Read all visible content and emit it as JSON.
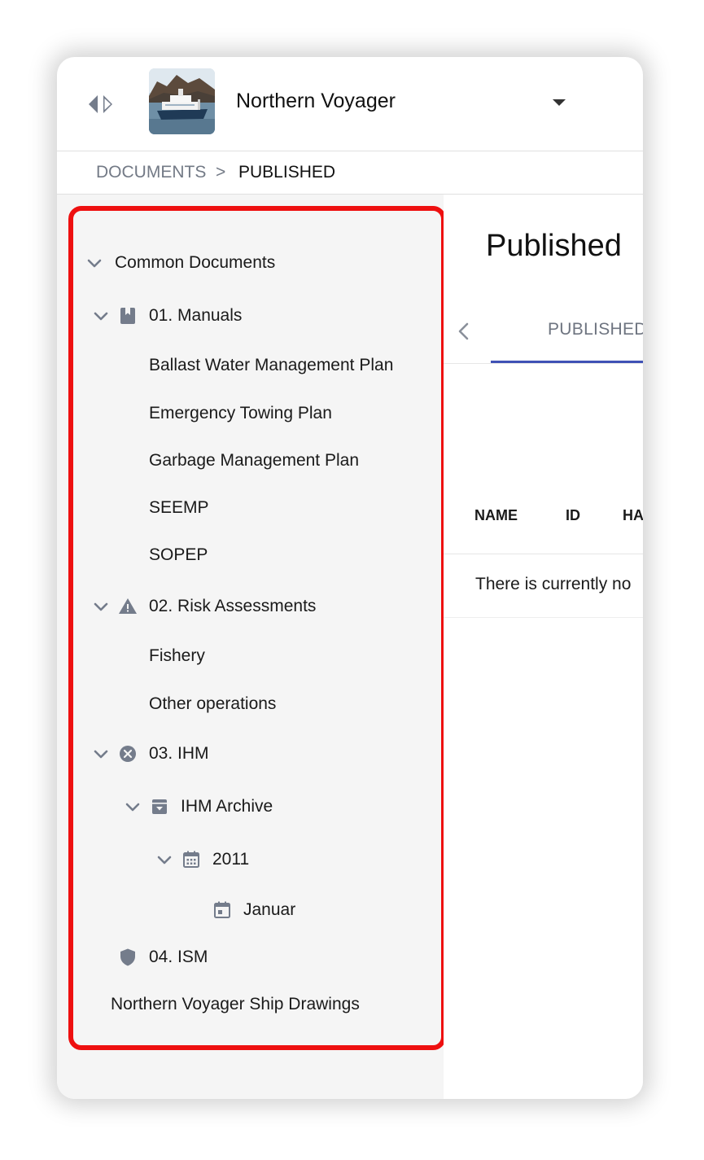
{
  "header": {
    "vessel_name": "Northern Voyager"
  },
  "breadcrumb": {
    "documents": "DOCUMENTS",
    "separator": ">",
    "current": "PUBLISHED"
  },
  "sidebar": {
    "root": "Common Documents",
    "manuals": {
      "label": "01. Manuals",
      "items": [
        "Ballast Water Management Plan",
        "Emergency Towing Plan",
        "Garbage Management Plan",
        "SEEMP",
        "SOPEP"
      ]
    },
    "risk": {
      "label": "02. Risk Assessments",
      "items": [
        "Fishery",
        "Other operations"
      ]
    },
    "ihm": {
      "label": "03. IHM",
      "archive": "IHM Archive",
      "year": "2011",
      "month": "Januar"
    },
    "ism": "04. ISM",
    "drawings": "Northern Voyager Ship Drawings"
  },
  "content": {
    "title": "Published",
    "tab_published": "PUBLISHED",
    "columns": [
      "NAME",
      "ID",
      "HA"
    ],
    "empty_message": "There is currently no"
  },
  "icons": {
    "collapse": "collapse-panel-icon",
    "dropdown": "caret-down-icon",
    "manuals": "book-icon",
    "risk": "warning-triangle-icon",
    "ihm": "cancel-circle-icon",
    "archive": "archive-box-icon",
    "year": "calendar-month-icon",
    "month": "calendar-day-icon",
    "ism": "shield-icon"
  },
  "colors": {
    "accent": "#3f51b5",
    "highlight": "#ee1010",
    "icon": "#747c8b",
    "sidebar_bg": "#f5f5f5"
  }
}
